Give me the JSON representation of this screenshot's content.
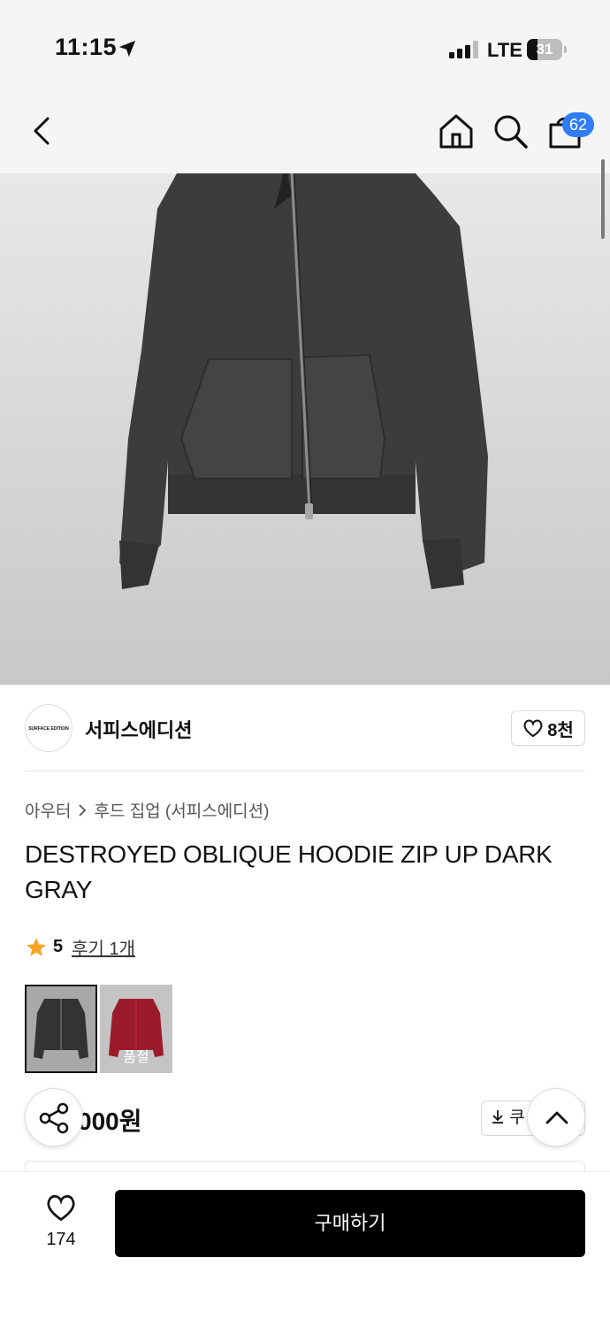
{
  "status_bar": {
    "time": "11:15",
    "network": "LTE",
    "battery": "31"
  },
  "nav": {
    "cart_count": "62"
  },
  "brand": {
    "logo_text": "SURFACE EDITION",
    "name": "서피스에디션",
    "likes": "8천"
  },
  "breadcrumb": {
    "category": "아우터",
    "subcategory": "후드 집업 (서피스에디션)"
  },
  "product": {
    "title": "DESTROYED OBLIQUE HOODIE ZIP UP DARK GRAY",
    "price": "000원"
  },
  "rating": {
    "score": "5",
    "reviews": "후기 1개",
    "star_color": "#f5a623"
  },
  "color_options": [
    {
      "color": "#3a3a3a",
      "selected": true
    },
    {
      "color": "#9c1b2a",
      "status": "품절"
    }
  ],
  "coupon": {
    "label": "쿠"
  },
  "bottom": {
    "wishlist_count": "174",
    "buy_label": "구매하기"
  },
  "accent": {
    "badge": "#2f7cf6",
    "buy_button": "#000000"
  }
}
